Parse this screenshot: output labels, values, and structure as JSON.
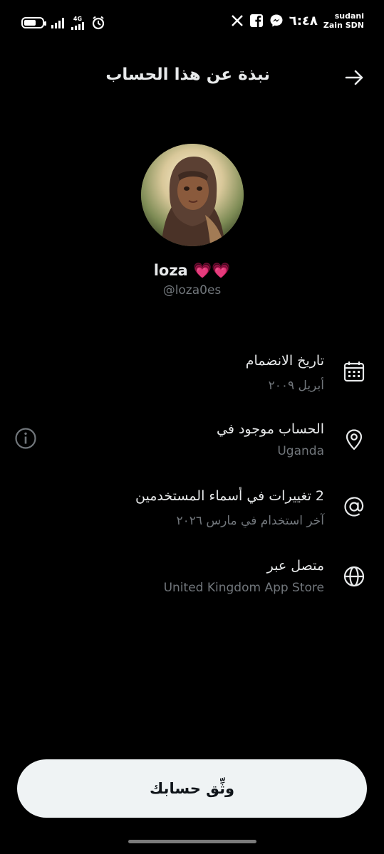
{
  "status_bar": {
    "network_label": "4G",
    "time": "٦:٤٨",
    "carrier_line1": "sudani",
    "carrier_line2": "Zain SDN",
    "icons": [
      "battery-icon",
      "signal-icon",
      "signal-icon-2",
      "alarm-icon",
      "x-app-icon",
      "facebook-icon",
      "messenger-icon"
    ]
  },
  "header": {
    "title": "نبذة عن هذا الحساب",
    "back_icon": "arrow-right-icon"
  },
  "profile": {
    "display_name": "loza 💗💗",
    "username": "@loza0es"
  },
  "info_rows": [
    {
      "icon": "calendar-icon",
      "title": "تاريخ الانضمام",
      "sub": "أبريل ٢٠٠٩"
    },
    {
      "icon": "location-pin-icon",
      "title": "الحساب موجود في",
      "sub": "Uganda"
    },
    {
      "icon": "at-sign-icon",
      "title": "2 تغييرات في أسماء المستخدمين",
      "sub": "آخر استخدام في مارس ٢٠٢٦"
    },
    {
      "icon": "globe-icon",
      "title": "متصل عبر",
      "sub": "United Kingdom App Store"
    }
  ],
  "verify_button": {
    "label": "وثِّق حسابك"
  },
  "colors": {
    "background": "#000000",
    "primary_text": "#e7e9ea",
    "secondary_text": "#71767b",
    "button_bg": "#eff3f4"
  }
}
